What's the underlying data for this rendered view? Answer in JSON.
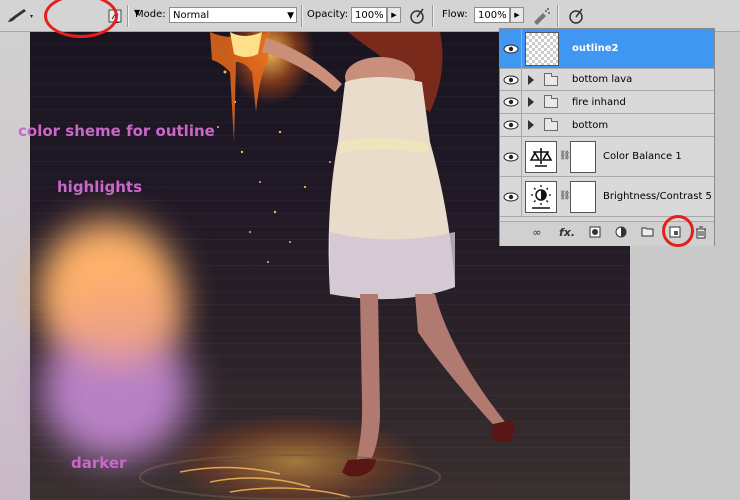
{
  "options_bar": {
    "tool_icon": "brush-icon",
    "brush_size": "1",
    "mode_label": "Mode:",
    "mode_value": "Normal",
    "opacity_label": "Opacity:",
    "opacity_value": "100%",
    "flow_label": "Flow:",
    "flow_value": "100%",
    "airbrush_icon": "airbrush-icon",
    "pressure_icon": "pressure-icon"
  },
  "annotations": {
    "color_scheme": "color sheme for outline",
    "highlights": "highlights",
    "darker": "darker"
  },
  "layers_panel": {
    "layers": [
      {
        "name": "outline2",
        "kind": "layer",
        "selected": true
      },
      {
        "name": "bottom lava",
        "kind": "group"
      },
      {
        "name": "fire inhand",
        "kind": "group"
      },
      {
        "name": "bottom",
        "kind": "group"
      },
      {
        "name": "Color Balance 1",
        "kind": "adjustment"
      },
      {
        "name": "Brightness/Contrast 5",
        "kind": "adjustment"
      }
    ],
    "footer_icons": [
      "link-icon",
      "fx-icon",
      "mask-icon",
      "adjustment-icon",
      "folder-icon",
      "new-layer-icon",
      "trash-icon"
    ],
    "fx_label": "fx."
  },
  "colors": {
    "selection": "#3f97f2",
    "annotation": "#c968c8",
    "highlight_circle": "#e3201b"
  }
}
